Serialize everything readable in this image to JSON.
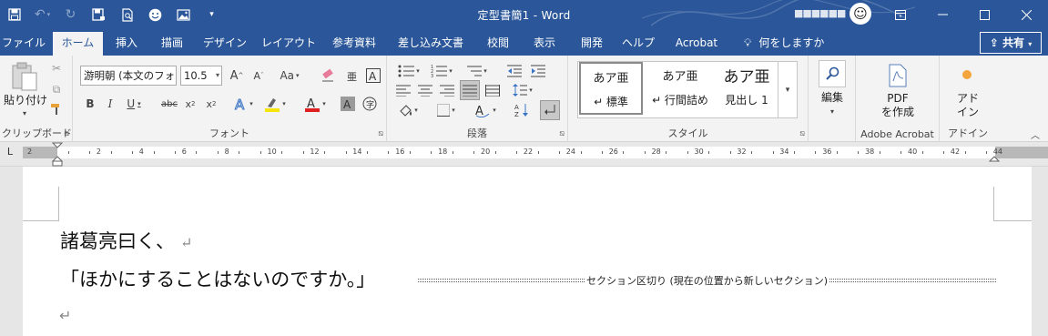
{
  "title_bar": {
    "document_title": "定型書簡1  -  Word",
    "user_name": "■■■■■■",
    "quick_access": [
      "save-icon",
      "undo-icon",
      "redo-icon",
      "save-as-icon",
      "print-preview-icon",
      "smiley-icon",
      "picture-icon",
      "customize-icon"
    ],
    "window_controls": [
      "ribbon-display-icon",
      "minimize-icon",
      "maximize-icon",
      "close-icon"
    ]
  },
  "tabs": [
    "ファイル",
    "ホーム",
    "挿入",
    "描画",
    "デザイン",
    "レイアウト",
    "参考資料",
    "差し込み文書",
    "校閲",
    "表示",
    "開発",
    "ヘルプ",
    "Acrobat"
  ],
  "active_tab": "ホーム",
  "tell_me": "何をしますか",
  "share": "共有",
  "ribbon": {
    "clipboard": {
      "label": "クリップボード",
      "paste": "貼り付け"
    },
    "font": {
      "label": "フォント",
      "font_name": "游明朝 (本文のフォ",
      "font_size": "10.5",
      "accent_highlight": "#f5e50a",
      "accent_fontcolor": "#e02020"
    },
    "paragraph": {
      "label": "段落"
    },
    "styles": {
      "label": "スタイル",
      "items": [
        {
          "sample": "あア亜",
          "name": "↵ 標準"
        },
        {
          "sample": "あア亜",
          "name": "↵ 行間詰め"
        },
        {
          "sample": "あア亜",
          "name": "見出し 1"
        }
      ]
    },
    "editing": {
      "label": "編集"
    },
    "adobe": {
      "button": "PDF\nを作成",
      "label": "Adobe Acrobat"
    },
    "addin": {
      "button": "アド\nイン",
      "label": "アドイン"
    }
  },
  "ruler": {
    "numbers": [
      "2",
      "2",
      "4",
      "6",
      "8",
      "10",
      "12",
      "14",
      "16",
      "18",
      "20",
      "22",
      "24",
      "26",
      "28",
      "30",
      "32",
      "34",
      "36",
      "38",
      "40",
      "42",
      "44"
    ]
  },
  "document": {
    "line1": "諸葛亮曰く、",
    "line2": "「ほかにすることはないのですか。」",
    "section_break": "セクション区切り (現在の位置から新しいセクション)",
    "paragraph_mark": "↵"
  }
}
